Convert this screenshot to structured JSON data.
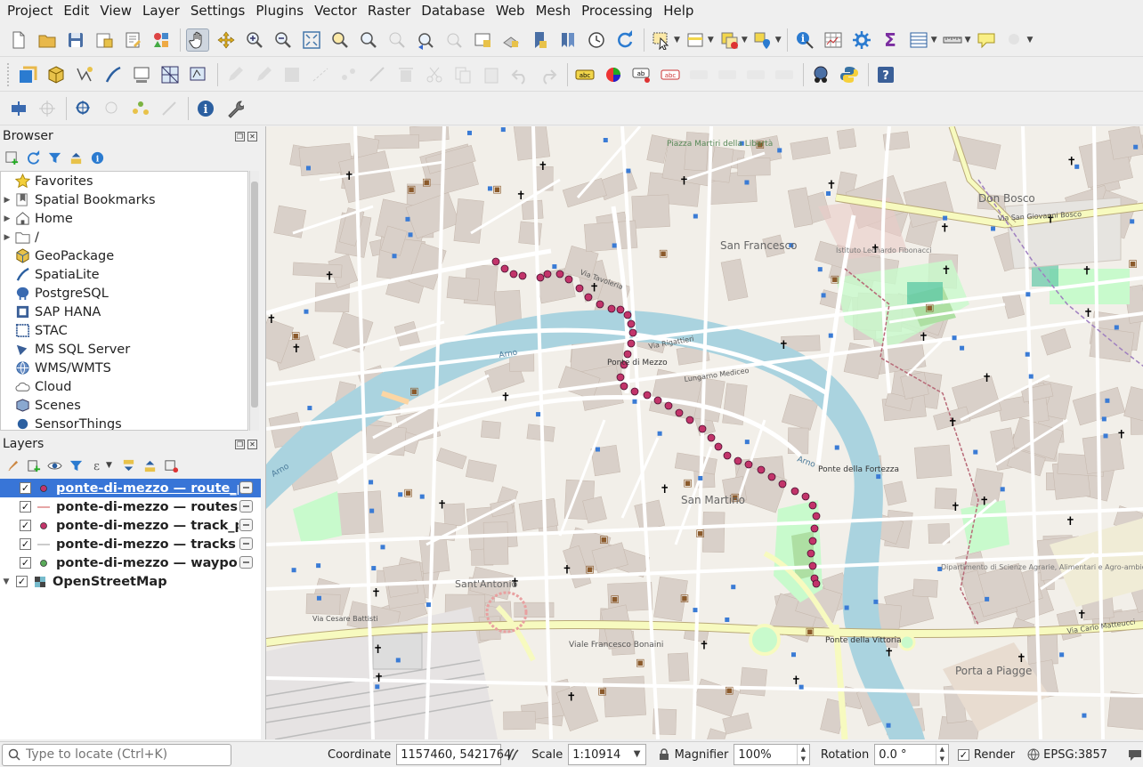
{
  "menu": [
    "Project",
    "Edit",
    "View",
    "Layer",
    "Settings",
    "Plugins",
    "Vector",
    "Raster",
    "Database",
    "Web",
    "Mesh",
    "Processing",
    "Help"
  ],
  "browser": {
    "title": "Browser",
    "items": [
      {
        "label": "Favorites",
        "icon": "star-icon",
        "expandable": false
      },
      {
        "label": "Spatial Bookmarks",
        "icon": "bookmark-icon",
        "expandable": true
      },
      {
        "label": "Home",
        "icon": "home-folder-icon",
        "expandable": true
      },
      {
        "label": "/",
        "icon": "folder-icon",
        "expandable": true
      },
      {
        "label": "GeoPackage",
        "icon": "geopackage-icon",
        "expandable": false
      },
      {
        "label": "SpatiaLite",
        "icon": "spatialite-icon",
        "expandable": false
      },
      {
        "label": "PostgreSQL",
        "icon": "postgresql-icon",
        "expandable": false
      },
      {
        "label": "SAP HANA",
        "icon": "sap-hana-icon",
        "expandable": false
      },
      {
        "label": "STAC",
        "icon": "stac-icon",
        "expandable": false
      },
      {
        "label": "MS SQL Server",
        "icon": "mssql-icon",
        "expandable": false
      },
      {
        "label": "WMS/WMTS",
        "icon": "globe-icon",
        "expandable": false
      },
      {
        "label": "Cloud",
        "icon": "cloud-icon",
        "expandable": false
      },
      {
        "label": "Scenes",
        "icon": "scenes-icon",
        "expandable": false
      },
      {
        "label": "SensorThings",
        "icon": "sensorthings-icon",
        "expandable": false
      }
    ]
  },
  "layers": {
    "title": "Layers",
    "items": [
      {
        "label": "ponte-di-mezzo — route_points",
        "symbol": "point",
        "checked": true,
        "selected": true
      },
      {
        "label": "ponte-di-mezzo — routes",
        "symbol": "line",
        "checked": true,
        "selected": false
      },
      {
        "label": "ponte-di-mezzo — track_points",
        "symbol": "point",
        "checked": true,
        "selected": false
      },
      {
        "label": "ponte-di-mezzo — tracks",
        "symbol": "line",
        "checked": true,
        "selected": false
      },
      {
        "label": "ponte-di-mezzo — waypoints",
        "symbol": "point-green",
        "checked": true,
        "selected": false
      },
      {
        "label": "OpenStreetMap",
        "symbol": "raster",
        "checked": true,
        "selected": false
      }
    ]
  },
  "map_labels": {
    "san_francesco": "San Francesco",
    "don_bosco": "Don Bosco",
    "san_martino": "San Martino",
    "sant_antonio": "Sant'Antonio",
    "porta_a_piagge": "Porta a Piagge",
    "piazza_martiri": "Piazza Martiri della Libertà",
    "ponte_di_mezzo": "Ponte di Mezzo",
    "ponte_fortezza": "Ponte della Fortezza",
    "ponte_vittoria": "Ponte della Vittoria",
    "arno_1": "Arno",
    "arno_2": "Arno",
    "arno_3": "Arno",
    "lungarno_mediceo": "Lungarno Mediceo",
    "viale_bonaini": "Viale Francesco Bonaini",
    "via_cesare_battisti": "Via Cesare Battisti",
    "via_san_giovanni_bosco": "Via San Giovanni Bosco",
    "via_tavoleria": "Via Tavoleria",
    "via_rigattieri": "Via Rigattieri",
    "istituto": "Istituto Leonardo Fibonacci",
    "dipartimento": "Dipartimento di Scienze Agrarie, Alimentari e Agro-ambientali",
    "via_carlo_matteucci": "Via Carlo Matteucci"
  },
  "status": {
    "locate_placeholder": "Type to locate (Ctrl+K)",
    "coordinate_label": "Coordinate",
    "coordinate_value": "1157460, 5421764",
    "scale_label": "Scale",
    "scale_value": "1:10914",
    "magnifier_label": "Magnifier",
    "magnifier_value": "100%",
    "rotation_label": "Rotation",
    "rotation_value": "0.0 °",
    "render_label": "Render",
    "crs_label": "EPSG:3857"
  },
  "colors": {
    "route": "#c2346a",
    "selection": "#3875d7",
    "river": "#aad3df",
    "park": "#c8facc",
    "road_primary": "#fcd6a4",
    "road_secondary": "#f7fabf"
  }
}
